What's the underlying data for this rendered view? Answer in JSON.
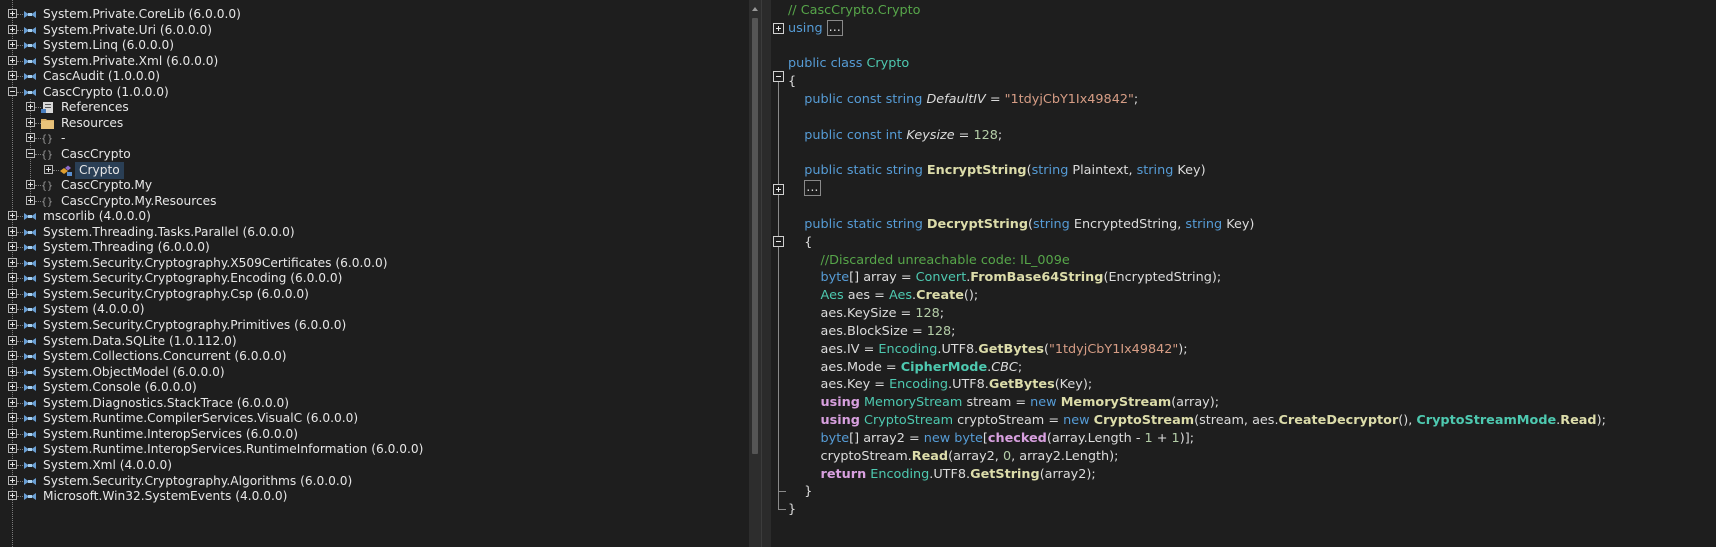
{
  "tree": {
    "items": [
      {
        "label": "System.Private.CoreLib (6.0.0.0)",
        "depth": 0,
        "state": "plus",
        "icon": "assembly-icon"
      },
      {
        "label": "System.Private.Uri (6.0.0.0)",
        "depth": 0,
        "state": "plus",
        "icon": "assembly-icon"
      },
      {
        "label": "System.Linq (6.0.0.0)",
        "depth": 0,
        "state": "plus",
        "icon": "assembly-icon"
      },
      {
        "label": "System.Private.Xml (6.0.0.0)",
        "depth": 0,
        "state": "plus",
        "icon": "assembly-icon"
      },
      {
        "label": "CascAudit (1.0.0.0)",
        "depth": 0,
        "state": "plus",
        "icon": "assembly-icon"
      },
      {
        "label": "CascCrypto (1.0.0.0)",
        "depth": 0,
        "state": "minus",
        "icon": "assembly-icon"
      },
      {
        "label": "References",
        "depth": 1,
        "state": "plus",
        "icon": "references-icon"
      },
      {
        "label": "Resources",
        "depth": 1,
        "state": "plus",
        "icon": "folder-icon"
      },
      {
        "label": "-",
        "depth": 1,
        "state": "plus",
        "icon": "namespace-icon"
      },
      {
        "label": "CascCrypto",
        "depth": 1,
        "state": "minus",
        "icon": "namespace-icon"
      },
      {
        "label": "Crypto",
        "depth": 2,
        "state": "plus",
        "icon": "class-icon",
        "selected": true
      },
      {
        "label": "CascCrypto.My",
        "depth": 1,
        "state": "plus",
        "icon": "namespace-icon"
      },
      {
        "label": "CascCrypto.My.Resources",
        "depth": 1,
        "state": "plus",
        "icon": "namespace-icon"
      },
      {
        "label": "mscorlib (4.0.0.0)",
        "depth": 0,
        "state": "plus",
        "icon": "assembly-icon"
      },
      {
        "label": "System.Threading.Tasks.Parallel (6.0.0.0)",
        "depth": 0,
        "state": "plus",
        "icon": "assembly-icon"
      },
      {
        "label": "System.Threading (6.0.0.0)",
        "depth": 0,
        "state": "plus",
        "icon": "assembly-icon"
      },
      {
        "label": "System.Security.Cryptography.X509Certificates (6.0.0.0)",
        "depth": 0,
        "state": "plus",
        "icon": "assembly-icon"
      },
      {
        "label": "System.Security.Cryptography.Encoding (6.0.0.0)",
        "depth": 0,
        "state": "plus",
        "icon": "assembly-icon"
      },
      {
        "label": "System.Security.Cryptography.Csp (6.0.0.0)",
        "depth": 0,
        "state": "plus",
        "icon": "assembly-icon"
      },
      {
        "label": "System (4.0.0.0)",
        "depth": 0,
        "state": "plus",
        "icon": "assembly-icon"
      },
      {
        "label": "System.Security.Cryptography.Primitives (6.0.0.0)",
        "depth": 0,
        "state": "plus",
        "icon": "assembly-icon"
      },
      {
        "label": "System.Data.SQLite (1.0.112.0)",
        "depth": 0,
        "state": "plus",
        "icon": "assembly-icon"
      },
      {
        "label": "System.Collections.Concurrent (6.0.0.0)",
        "depth": 0,
        "state": "plus",
        "icon": "assembly-icon"
      },
      {
        "label": "System.ObjectModel (6.0.0.0)",
        "depth": 0,
        "state": "plus",
        "icon": "assembly-icon"
      },
      {
        "label": "System.Console (6.0.0.0)",
        "depth": 0,
        "state": "plus",
        "icon": "assembly-icon"
      },
      {
        "label": "System.Diagnostics.StackTrace (6.0.0.0)",
        "depth": 0,
        "state": "plus",
        "icon": "assembly-icon"
      },
      {
        "label": "System.Runtime.CompilerServices.VisualC (6.0.0.0)",
        "depth": 0,
        "state": "plus",
        "icon": "assembly-icon"
      },
      {
        "label": "System.Runtime.InteropServices (6.0.0.0)",
        "depth": 0,
        "state": "plus",
        "icon": "assembly-icon"
      },
      {
        "label": "System.Runtime.InteropServices.RuntimeInformation (6.0.0.0)",
        "depth": 0,
        "state": "plus",
        "icon": "assembly-icon"
      },
      {
        "label": "System.Xml (4.0.0.0)",
        "depth": 0,
        "state": "plus",
        "icon": "assembly-icon"
      },
      {
        "label": "System.Security.Cryptography.Algorithms (6.0.0.0)",
        "depth": 0,
        "state": "plus",
        "icon": "assembly-icon"
      },
      {
        "label": "Microsoft.Win32.SystemEvents (4.0.0.0)",
        "depth": 0,
        "state": "plus",
        "icon": "assembly-icon"
      }
    ]
  },
  "code": {
    "lines": [
      [
        {
          "t": "// CascCrypto.Crypto",
          "c": "cm"
        }
      ],
      [
        {
          "t": "using",
          "c": "kw"
        },
        {
          "t": " "
        },
        {
          "t": "...",
          "c": "box"
        }
      ],
      [],
      [
        {
          "t": "public",
          "c": "kw"
        },
        {
          "t": " "
        },
        {
          "t": "class",
          "c": "kw"
        },
        {
          "t": " "
        },
        {
          "t": "Crypto",
          "c": "tp"
        }
      ],
      [
        {
          "t": "{"
        }
      ],
      [
        {
          "t": "    "
        },
        {
          "t": "public",
          "c": "kw"
        },
        {
          "t": " "
        },
        {
          "t": "const",
          "c": "kw"
        },
        {
          "t": " "
        },
        {
          "t": "string",
          "c": "kw"
        },
        {
          "t": " "
        },
        {
          "t": "DefaultIV",
          "c": "it"
        },
        {
          "t": " = "
        },
        {
          "t": "\"1tdyjCbY1Ix49842\"",
          "c": "str"
        },
        {
          "t": ";"
        }
      ],
      [],
      [
        {
          "t": "    "
        },
        {
          "t": "public",
          "c": "kw"
        },
        {
          "t": " "
        },
        {
          "t": "const",
          "c": "kw"
        },
        {
          "t": " "
        },
        {
          "t": "int",
          "c": "kw"
        },
        {
          "t": " "
        },
        {
          "t": "Keysize",
          "c": "it"
        },
        {
          "t": " = "
        },
        {
          "t": "128",
          "c": "num"
        },
        {
          "t": ";"
        }
      ],
      [],
      [
        {
          "t": "    "
        },
        {
          "t": "public",
          "c": "kw"
        },
        {
          "t": " "
        },
        {
          "t": "static",
          "c": "kw"
        },
        {
          "t": " "
        },
        {
          "t": "string",
          "c": "kw"
        },
        {
          "t": " "
        },
        {
          "t": "EncryptString",
          "c": "fn"
        },
        {
          "t": "("
        },
        {
          "t": "string",
          "c": "kw"
        },
        {
          "t": " Plaintext, "
        },
        {
          "t": "string",
          "c": "kw"
        },
        {
          "t": " Key)"
        }
      ],
      [
        {
          "t": "    "
        },
        {
          "t": "...",
          "c": "box"
        }
      ],
      [],
      [
        {
          "t": "    "
        },
        {
          "t": "public",
          "c": "kw"
        },
        {
          "t": " "
        },
        {
          "t": "static",
          "c": "kw"
        },
        {
          "t": " "
        },
        {
          "t": "string",
          "c": "kw"
        },
        {
          "t": " "
        },
        {
          "t": "DecryptString",
          "c": "fn"
        },
        {
          "t": "("
        },
        {
          "t": "string",
          "c": "kw"
        },
        {
          "t": " EncryptedString, "
        },
        {
          "t": "string",
          "c": "kw"
        },
        {
          "t": " Key)"
        }
      ],
      [
        {
          "t": "    {"
        }
      ],
      [
        {
          "t": "        "
        },
        {
          "t": "//Discarded unreachable code: IL_009e",
          "c": "cm"
        }
      ],
      [
        {
          "t": "        "
        },
        {
          "t": "byte",
          "c": "kw"
        },
        {
          "t": "[] array = "
        },
        {
          "t": "Convert",
          "c": "tp"
        },
        {
          "t": "."
        },
        {
          "t": "FromBase64String",
          "c": "fn"
        },
        {
          "t": "(EncryptedString);"
        }
      ],
      [
        {
          "t": "        "
        },
        {
          "t": "Aes",
          "c": "tp"
        },
        {
          "t": " aes = "
        },
        {
          "t": "Aes",
          "c": "tp"
        },
        {
          "t": "."
        },
        {
          "t": "Create",
          "c": "fn"
        },
        {
          "t": "();"
        }
      ],
      [
        {
          "t": "        aes.KeySize = "
        },
        {
          "t": "128",
          "c": "num"
        },
        {
          "t": ";"
        }
      ],
      [
        {
          "t": "        aes.BlockSize = "
        },
        {
          "t": "128",
          "c": "num"
        },
        {
          "t": ";"
        }
      ],
      [
        {
          "t": "        aes.IV = "
        },
        {
          "t": "Encoding",
          "c": "tp"
        },
        {
          "t": ".UTF8."
        },
        {
          "t": "GetBytes",
          "c": "fn"
        },
        {
          "t": "("
        },
        {
          "t": "\"1tdyjCbY1Ix49842\"",
          "c": "str"
        },
        {
          "t": ");"
        }
      ],
      [
        {
          "t": "        aes.Mode = "
        },
        {
          "t": "CipherMode",
          "c": "tpb"
        },
        {
          "t": "."
        },
        {
          "t": "CBC",
          "c": "it"
        },
        {
          "t": ";"
        }
      ],
      [
        {
          "t": "        aes.Key = "
        },
        {
          "t": "Encoding",
          "c": "tp"
        },
        {
          "t": ".UTF8."
        },
        {
          "t": "GetBytes",
          "c": "fn"
        },
        {
          "t": "(Key);"
        }
      ],
      [
        {
          "t": "        "
        },
        {
          "t": "using",
          "c": "kw2"
        },
        {
          "t": " "
        },
        {
          "t": "MemoryStream",
          "c": "tp"
        },
        {
          "t": " stream = "
        },
        {
          "t": "new",
          "c": "kw"
        },
        {
          "t": " "
        },
        {
          "t": "MemoryStream",
          "c": "fn"
        },
        {
          "t": "(array);"
        }
      ],
      [
        {
          "t": "        "
        },
        {
          "t": "using",
          "c": "kw2"
        },
        {
          "t": " "
        },
        {
          "t": "CryptoStream",
          "c": "tp"
        },
        {
          "t": " cryptoStream = "
        },
        {
          "t": "new",
          "c": "kw"
        },
        {
          "t": " "
        },
        {
          "t": "CryptoStream",
          "c": "fn"
        },
        {
          "t": "(stream, aes."
        },
        {
          "t": "CreateDecryptor",
          "c": "fn"
        },
        {
          "t": "(), "
        },
        {
          "t": "CryptoStreamMode",
          "c": "tpb"
        },
        {
          "t": "."
        },
        {
          "t": "Read",
          "c": "fn"
        },
        {
          "t": ");"
        }
      ],
      [
        {
          "t": "        "
        },
        {
          "t": "byte",
          "c": "kw"
        },
        {
          "t": "[] array2 = "
        },
        {
          "t": "new",
          "c": "kw"
        },
        {
          "t": " "
        },
        {
          "t": "byte",
          "c": "kw"
        },
        {
          "t": "["
        },
        {
          "t": "checked",
          "c": "kw2"
        },
        {
          "t": "(array.Length - "
        },
        {
          "t": "1",
          "c": "num"
        },
        {
          "t": " + "
        },
        {
          "t": "1",
          "c": "num"
        },
        {
          "t": ")];"
        }
      ],
      [
        {
          "t": "        cryptoStream."
        },
        {
          "t": "Read",
          "c": "fn"
        },
        {
          "t": "(array2, "
        },
        {
          "t": "0",
          "c": "num"
        },
        {
          "t": ", array2.Length);"
        }
      ],
      [
        {
          "t": "        "
        },
        {
          "t": "return",
          "c": "kw2"
        },
        {
          "t": " "
        },
        {
          "t": "Encoding",
          "c": "tp"
        },
        {
          "t": ".UTF8."
        },
        {
          "t": "GetString",
          "c": "fn"
        },
        {
          "t": "(array2);"
        }
      ],
      [
        {
          "t": "    }"
        }
      ],
      [
        {
          "t": "}"
        }
      ]
    ]
  }
}
